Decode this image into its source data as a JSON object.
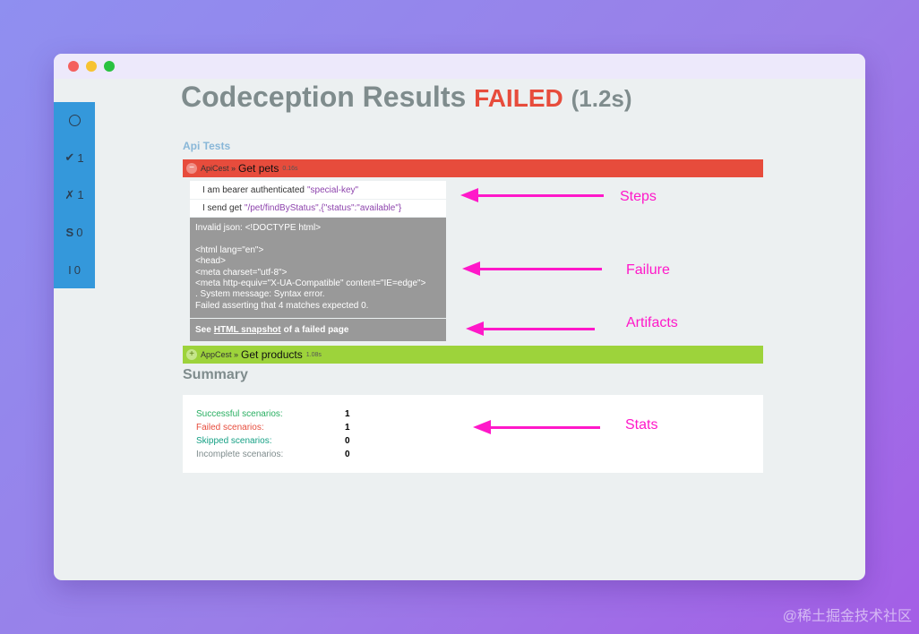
{
  "sidebar": {
    "items": [
      {
        "icon": "circle-icon",
        "glyph": "",
        "count": ""
      },
      {
        "icon": "checkmark-icon",
        "glyph": "✔",
        "count": "1"
      },
      {
        "icon": "cross-icon",
        "glyph": "✗",
        "count": "1"
      },
      {
        "icon": "skipped-icon",
        "glyph": "S",
        "count": "0"
      },
      {
        "icon": "incomplete-icon",
        "glyph": "I",
        "count": "0"
      }
    ]
  },
  "report": {
    "title": "Codeception Results",
    "status": "FAILED",
    "duration": "(1.2s)",
    "suite": "Api Tests"
  },
  "scenarios": [
    {
      "toggle": "−",
      "class_name": "ApiCest »",
      "name": "Get pets",
      "time": "0.16s",
      "steps": [
        {
          "text": "I am bearer authenticated",
          "arg": "\"special-key\""
        },
        {
          "text": "I send get",
          "arg": "\"/pet/findByStatus\",{\"status\":\"available\"}"
        }
      ],
      "failure": "Invalid json: <!DOCTYPE html>\n\n<html lang=\"en\">\n<head>\n<meta charset=\"utf-8\">\n<meta http-equiv=\"X-UA-Compatible\" content=\"IE=edge\">\n. System message: Syntax error.\nFailed asserting that 4 matches expected 0.",
      "artifacts": {
        "prefix": "See",
        "link": "HTML snapshot",
        "suffix": "of a failed page"
      }
    },
    {
      "toggle": "+",
      "class_name": "AppCest »",
      "name": "Get products",
      "time": "1.08s"
    }
  ],
  "summary": {
    "title": "Summary",
    "rows": [
      {
        "label": "Successful scenarios:",
        "value": "1"
      },
      {
        "label": "Failed scenarios:",
        "value": "1"
      },
      {
        "label": "Skipped scenarios:",
        "value": "0"
      },
      {
        "label": "Incomplete scenarios:",
        "value": "0"
      }
    ]
  },
  "annotations": {
    "steps": "Steps",
    "failure": "Failure",
    "artifacts": "Artifacts",
    "stats": "Stats",
    "color": "#ff18c9"
  },
  "watermark": "@稀土掘金技术社区",
  "colors": {
    "failed": "#e74c3c",
    "passed": "#9dd33b",
    "sidebar": "#3498db"
  }
}
